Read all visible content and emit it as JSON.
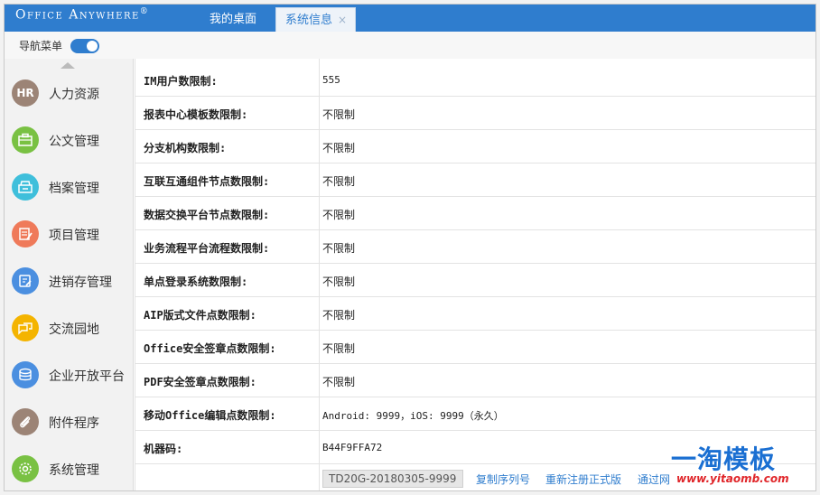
{
  "brand": {
    "name": "Office Anywhere",
    "mark": "®"
  },
  "tabs": [
    {
      "label": "我的桌面",
      "active": false
    },
    {
      "label": "系统信息",
      "active": true,
      "close": "×"
    }
  ],
  "nav_toggle": {
    "label": "导航菜单",
    "on": true
  },
  "sidebar": {
    "items": [
      {
        "label": "人力资源",
        "icon": "hr-icon",
        "icon_text": "HR",
        "color": "#9c8476"
      },
      {
        "label": "公文管理",
        "icon": "briefcase-icon",
        "color": "#79c143"
      },
      {
        "label": "档案管理",
        "icon": "archive-icon",
        "color": "#3fbfdb"
      },
      {
        "label": "项目管理",
        "icon": "project-icon",
        "color": "#ef7a5a"
      },
      {
        "label": "进销存管理",
        "icon": "inventory-icon",
        "color": "#4b8fe0"
      },
      {
        "label": "交流园地",
        "icon": "chat-icon",
        "color": "#f4b400"
      },
      {
        "label": "企业开放平台",
        "icon": "open-platform-icon",
        "color": "#4b8fe0"
      },
      {
        "label": "附件程序",
        "icon": "paperclip-icon",
        "color": "#9c8476"
      },
      {
        "label": "系统管理",
        "icon": "gear-icon",
        "color": "#79c143"
      }
    ]
  },
  "info_rows": [
    {
      "key": "IM用户数限制:",
      "value": "555"
    },
    {
      "key": "报表中心模板数限制:",
      "value": "不限制"
    },
    {
      "key": "分支机构数限制:",
      "value": "不限制"
    },
    {
      "key": "互联互通组件节点数限制:",
      "value": "不限制"
    },
    {
      "key": "数据交换平台节点数限制:",
      "value": "不限制"
    },
    {
      "key": "业务流程平台流程数限制:",
      "value": "不限制"
    },
    {
      "key": "单点登录系统数限制:",
      "value": "不限制"
    },
    {
      "key": "AIP版式文件点数限制:",
      "value": "不限制"
    },
    {
      "key": "Office安全签章点数限制:",
      "value": "不限制"
    },
    {
      "key": "PDF安全签章点数限制:",
      "value": "不限制"
    },
    {
      "key": "移动Office编辑点数限制:",
      "value": "Android: 9999，iOS: 9999（永久）"
    },
    {
      "key": "机器码:",
      "value": "B44F9FFA72"
    }
  ],
  "serial": {
    "value": "TD20G-20180305-9999"
  },
  "actions": {
    "copy_serial": "复制序列号",
    "reregister": "重新注册正式版",
    "via_network": "通过网"
  },
  "watermark": {
    "big": "一淘模板",
    "small": "www.yitaomb.com"
  },
  "colors": {
    "primary": "#2f7dce",
    "sidebar_bg": "#f2f2f2"
  }
}
